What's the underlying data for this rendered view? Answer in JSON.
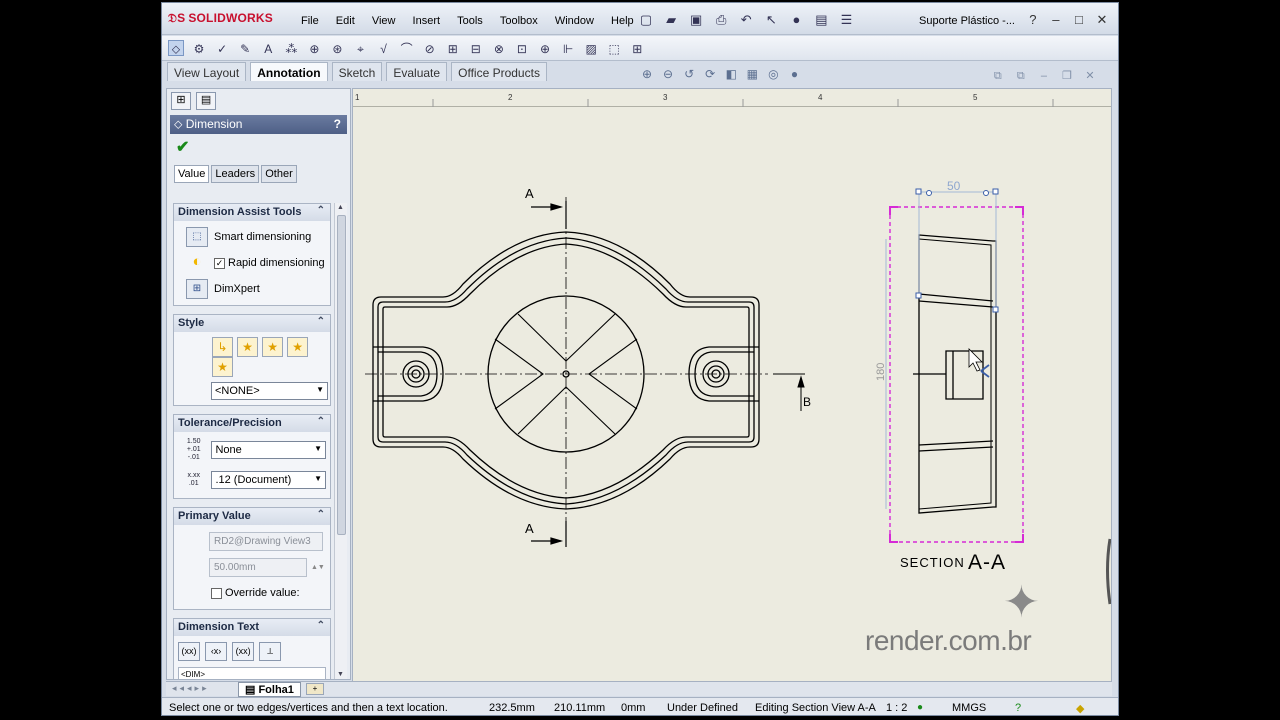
{
  "app": {
    "logo_text": "SOLIDWORKS",
    "menus": [
      "File",
      "Edit",
      "View",
      "Insert",
      "Tools",
      "Toolbox",
      "Window",
      "Help"
    ],
    "doc_title": "Suporte Plástico -...",
    "win_controls": [
      "?",
      "–",
      "□",
      "✕"
    ]
  },
  "command_tabs": [
    "View Layout",
    "Annotation",
    "Sketch",
    "Evaluate",
    "Office Products"
  ],
  "active_tab": "Annotation",
  "property_manager": {
    "title": "Dimension",
    "help": "?",
    "tabs": [
      "Value",
      "Leaders",
      "Other"
    ],
    "assist": {
      "header": "Dimension Assist Tools",
      "smart": "Smart dimensioning",
      "rapid": "Rapid dimensioning",
      "rapid_checked": true,
      "dimxpert": "DimXpert"
    },
    "style": {
      "header": "Style",
      "value": "<NONE>"
    },
    "tolerance": {
      "header": "Tolerance/Precision",
      "tol_icon": "1.50 +.01 -.01",
      "prec_icon": "x.xx .01",
      "tolerance_value": "None",
      "precision_value": ".12 (Document)"
    },
    "primary": {
      "header": "Primary Value",
      "reference": "RD2@Drawing View3",
      "value": "50.00mm",
      "override_label": "Override value:"
    },
    "dim_text": {
      "header": "Dimension Text",
      "buttons": [
        "(xx)",
        "‹x›",
        "(xx)",
        "⟂"
      ],
      "content": "<DIM>"
    }
  },
  "ruler": [
    "1",
    "2",
    "3",
    "4",
    "5"
  ],
  "drawing": {
    "section_label_small": "A",
    "section_label_b": "B",
    "dim_top": "50",
    "dim_side": "180",
    "section_caption_small": "SECTION",
    "section_caption_big": "A-A"
  },
  "watermark": "render.com.br",
  "sheet_tab": "Folha1",
  "status": {
    "hint": "Select one or two edges/vertices and then a text location.",
    "x": "232.5mm",
    "y": "210.11mm",
    "z": "0mm",
    "state": "Under Defined",
    "editing": "Editing Section View A-A",
    "scale": "1 : 2",
    "units": "MMGS"
  },
  "colors": {
    "selection": "#d62ad6",
    "accent": "#4e5f86"
  }
}
